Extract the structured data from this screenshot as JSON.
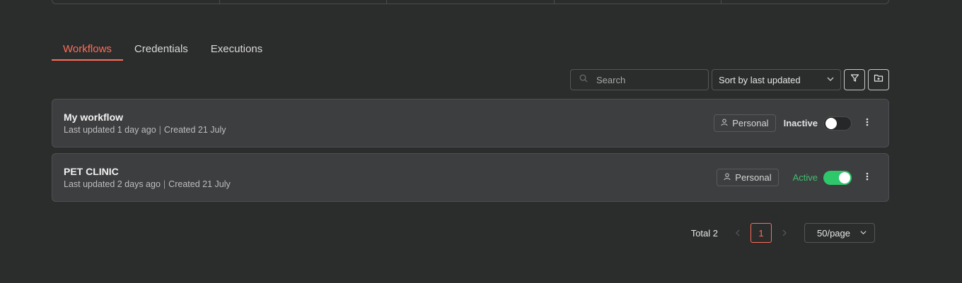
{
  "tabs": [
    {
      "label": "Workflows",
      "active": true
    },
    {
      "label": "Credentials",
      "active": false
    },
    {
      "label": "Executions",
      "active": false
    }
  ],
  "toolbar": {
    "search_placeholder": "Search",
    "sort_label": "Sort by last updated",
    "filter_icon": "filter-icon",
    "folder_icon": "add-folder-icon"
  },
  "workflows": [
    {
      "name": "My workflow",
      "updated": "Last updated 1 day ago",
      "created": "Created 21 July",
      "owner": "Personal",
      "status": "Inactive",
      "active": false
    },
    {
      "name": "PET CLINIC",
      "updated": "Last updated 2 days ago",
      "created": "Created 21 July",
      "owner": "Personal",
      "status": "Active",
      "active": true
    }
  ],
  "pagination": {
    "total": "Total 2",
    "current_page": "1",
    "page_size": "50/page"
  },
  "colors": {
    "accent": "#ff6d5a",
    "active_green": "#2ec76a",
    "background": "#2b2c2c",
    "card": "#3d3e40"
  }
}
